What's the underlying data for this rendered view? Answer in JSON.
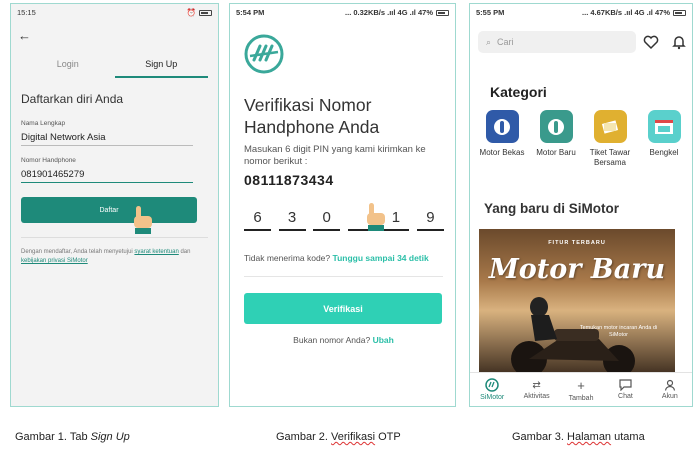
{
  "colors": {
    "brand": "#1e8a7a",
    "accent": "#2fd0b5",
    "link": "#2bbfa8"
  },
  "screen1": {
    "status_time": "15:15",
    "back_icon": "arrow-left-icon",
    "tab_login": "Login",
    "tab_signup": "Sign Up",
    "heading": "Daftarkan diri Anda",
    "name_label": "Nama Lengkap",
    "name_value": "Digital Network Asia",
    "phone_label": "Nomor Handphone",
    "phone_value": "081901465279",
    "submit_label": "Daftar",
    "terms_prefix": "Dengan mendaftar, Anda telah menyetujui",
    "terms_link1": "syarat ketentuan",
    "terms_mid": "dan",
    "terms_link2": "kebijakan privasi SiMotor"
  },
  "screen2": {
    "status_time": "5:54 PM",
    "status_right": "... 0.32KB/s .ııl 4G .ıl 47%",
    "title": "Verifikasi Nomor Handphone Anda",
    "description": "Masukan 6 digit PIN yang kami kirimkan ke nomor berikut :",
    "phone_number": "08111873434",
    "pin_digits": [
      "6",
      "3",
      "0",
      "",
      "1",
      "9"
    ],
    "resend_prompt": "Tidak menerima kode?",
    "resend_timer": "Tunggu sampai 34 detik",
    "verify_button": "Verifikasi",
    "not_your_number": "Bukan nomor Anda?",
    "change_link": "Ubah"
  },
  "screen3": {
    "status_time": "5:55 PM",
    "status_right": "... 4.67KB/s .ııl 4G .ıl 47%",
    "search_placeholder": "Cari",
    "categories_title": "Kategori",
    "categories": [
      {
        "label": "Motor Bekas",
        "icon": "motorcycle-icon",
        "color": "#2f5aa8"
      },
      {
        "label": "Motor Baru",
        "icon": "motorcycle-new-icon",
        "color": "#3a9a8c"
      },
      {
        "label": "Tiket Tawar Bersama",
        "icon": "tickets-icon",
        "color": "#e0b030"
      },
      {
        "label": "Bengkel",
        "icon": "workshop-icon",
        "color": "#5ad0cc"
      }
    ],
    "new_title": "Yang baru di SiMotor",
    "banner_small": "FITUR TERBARU",
    "banner_big": "Motor Baru",
    "banner_sub": "Temukan motor incaran Anda di SiMotor",
    "nav": [
      {
        "label": "SiMotor",
        "icon": "simotor-logo-icon"
      },
      {
        "label": "Aktivitas",
        "icon": "activity-icon"
      },
      {
        "label": "Tambah",
        "icon": "plus-icon"
      },
      {
        "label": "Chat",
        "icon": "chat-icon"
      },
      {
        "label": "Akun",
        "icon": "user-icon"
      }
    ]
  },
  "captions": {
    "c1_prefix": "Gambar 1. Tab",
    "c1_italic": "Sign Up",
    "c2_prefix": "Gambar 2.",
    "c2_word": "Verifikasi",
    "c2_suffix": "OTP",
    "c3_prefix": "Gambar 3.",
    "c3_word": "Halaman",
    "c3_suffix": "utama"
  }
}
